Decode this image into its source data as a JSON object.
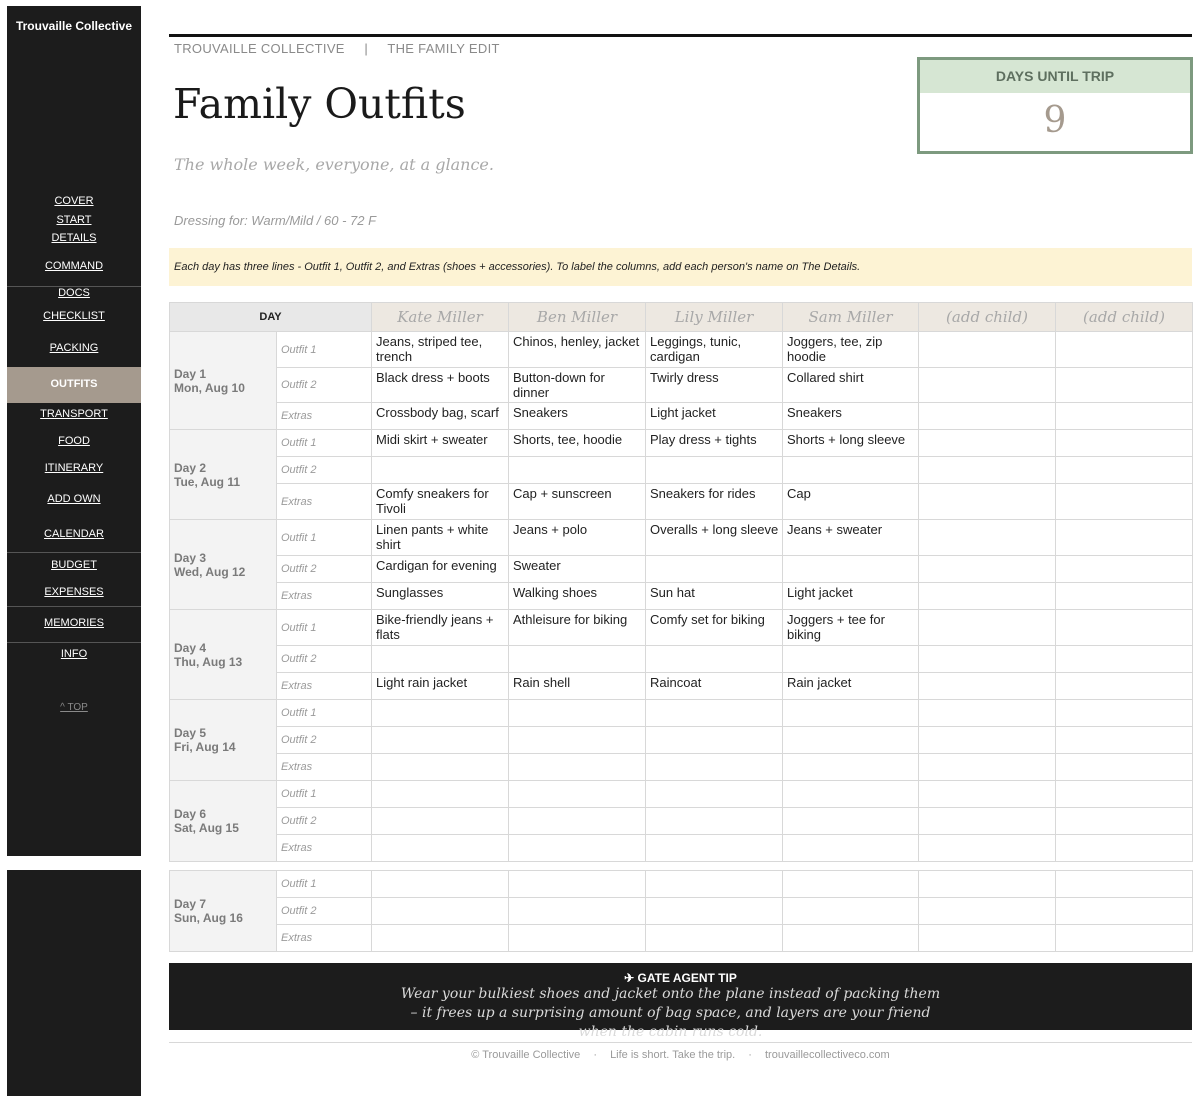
{
  "sidebar": {
    "brand": "Trouvaille Collective",
    "nav": [
      "COVER",
      "START",
      "DETAILS",
      "COMMAND",
      "DOCS",
      "CHECKLIST",
      "PACKING",
      "OUTFITS",
      "TRANSPORT",
      "FOOD",
      "ITINERARY",
      "ADD OWN",
      "CALENDAR",
      "BUDGET",
      "EXPENSES",
      "MEMORIES",
      "INFO"
    ],
    "active": "OUTFITS",
    "top_link": "^ TOP"
  },
  "header": {
    "brand": "TROUVAILLE COLLECTIVE",
    "divider": "|",
    "section": "THE FAMILY EDIT",
    "title": "Family Outfits",
    "subtitle": "The whole week, everyone, at a glance.",
    "dressing": "Dressing for: Warm/Mild / 60 - 72 F"
  },
  "countdown": {
    "label": "DAYS UNTIL TRIP",
    "value": "9"
  },
  "note": "Each day has three lines - Outfit 1, Outfit 2, and Extras (shoes + accessories). To label the columns, add each person's name on The Details.",
  "table": {
    "day_header": "DAY",
    "people": [
      "Kate Miller",
      "Ben Miller",
      "Lily Miller",
      "Sam Miller",
      "(add child)",
      "(add child)"
    ],
    "line_labels": [
      "Outfit 1",
      "Outfit 2",
      "Extras"
    ],
    "days": [
      {
        "day": "Day 1",
        "date": "Mon, Aug 10",
        "rows": [
          [
            "Jeans, striped tee, trench",
            "Chinos, henley, jacket",
            "Leggings, tunic, cardigan",
            "Joggers, tee, zip hoodie",
            "",
            ""
          ],
          [
            "Black dress + boots",
            "Button-down for dinner",
            "Twirly dress",
            "Collared shirt",
            "",
            ""
          ],
          [
            "Crossbody bag, scarf",
            "Sneakers",
            "Light jacket",
            "Sneakers",
            "",
            ""
          ]
        ]
      },
      {
        "day": "Day 2",
        "date": "Tue, Aug 11",
        "rows": [
          [
            "Midi skirt + sweater",
            "Shorts, tee, hoodie",
            "Play dress + tights",
            "Shorts + long sleeve",
            "",
            ""
          ],
          [
            "",
            "",
            "",
            "",
            "",
            ""
          ],
          [
            "Comfy sneakers for Tivoli",
            "Cap + sunscreen",
            "Sneakers for rides",
            "Cap",
            "",
            ""
          ]
        ]
      },
      {
        "day": "Day 3",
        "date": "Wed, Aug 12",
        "rows": [
          [
            "Linen pants + white shirt",
            "Jeans + polo",
            "Overalls + long sleeve",
            "Jeans + sweater",
            "",
            ""
          ],
          [
            "Cardigan for evening",
            "Sweater",
            "",
            "",
            "",
            ""
          ],
          [
            "Sunglasses",
            "Walking shoes",
            "Sun hat",
            "Light jacket",
            "",
            ""
          ]
        ]
      },
      {
        "day": "Day 4",
        "date": "Thu, Aug 13",
        "rows": [
          [
            "Bike-friendly jeans + flats",
            "Athleisure for biking",
            "Comfy set for biking",
            "Joggers + tee for biking",
            "",
            ""
          ],
          [
            "",
            "",
            "",
            "",
            "",
            ""
          ],
          [
            "Light rain jacket",
            "Rain shell",
            "Raincoat",
            "Rain jacket",
            "",
            ""
          ]
        ]
      },
      {
        "day": "Day 5",
        "date": "Fri, Aug 14",
        "rows": [
          [
            "",
            "",
            "",
            "",
            "",
            ""
          ],
          [
            "",
            "",
            "",
            "",
            "",
            ""
          ],
          [
            "",
            "",
            "",
            "",
            "",
            ""
          ]
        ]
      },
      {
        "day": "Day 6",
        "date": "Sat, Aug 15",
        "rows": [
          [
            "",
            "",
            "",
            "",
            "",
            ""
          ],
          [
            "",
            "",
            "",
            "",
            "",
            ""
          ],
          [
            "",
            "",
            "",
            "",
            "",
            ""
          ]
        ]
      },
      {
        "day": "Day 7",
        "date": "Sun, Aug 16",
        "rows": [
          [
            "",
            "",
            "",
            "",
            "",
            ""
          ],
          [
            "",
            "",
            "",
            "",
            "",
            ""
          ],
          [
            "",
            "",
            "",
            "",
            "",
            ""
          ]
        ]
      }
    ]
  },
  "tip": {
    "icon": "airplane-icon",
    "heading": "GATE AGENT TIP",
    "body": "Wear your bulkiest shoes and jacket onto the plane instead of packing them – it frees up a surprising amount of bag space, and layers are your friend when the cabin runs cold."
  },
  "footer": {
    "copyright": "© Trouvaille Collective",
    "sep": "·",
    "tagline": "Life is short. Take the trip.",
    "url": "trouvaillecollectiveco.com"
  },
  "colors": {
    "sidebar": "#1c1c1c",
    "active_nav": "#a59a8e",
    "countdown_border": "#7d9a7f",
    "countdown_label_bg": "#d6e6d3",
    "note_bg": "#fdf3d4"
  }
}
